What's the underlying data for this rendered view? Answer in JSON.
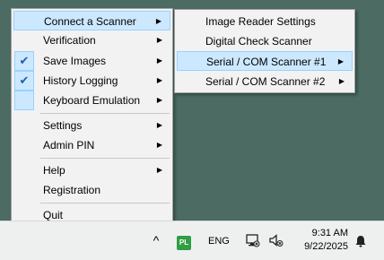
{
  "menu": {
    "items": [
      {
        "label": "Connect a Scanner",
        "has_submenu": true
      },
      {
        "label": "Verification",
        "has_submenu": true
      },
      {
        "label": "Save Images",
        "has_submenu": true,
        "checked": true
      },
      {
        "label": "History Logging",
        "has_submenu": true,
        "checked": true
      },
      {
        "label": "Keyboard Emulation",
        "has_submenu": true
      },
      {
        "label": "Settings",
        "has_submenu": true
      },
      {
        "label": "Admin PIN",
        "has_submenu": true
      },
      {
        "label": "Help",
        "has_submenu": true
      },
      {
        "label": "Registration"
      },
      {
        "label": "Quit"
      }
    ],
    "arrow": "▶",
    "check": "✔"
  },
  "submenu": {
    "items": [
      {
        "label": "Image Reader Settings"
      },
      {
        "label": "Digital Check Scanner"
      },
      {
        "label": "Serial / COM Scanner #1",
        "has_submenu": true
      },
      {
        "label": "Serial / COM Scanner #2",
        "has_submenu": true
      }
    ]
  },
  "taskbar": {
    "overflow_glyph": "^",
    "app_icon_text": "PL",
    "language": "ENG",
    "time": "9:31 AM",
    "date": "9/22/2025"
  },
  "colors": {
    "desktop": "#4b6b63",
    "highlight": "#cce8ff",
    "highlight_border": "#99d1ff",
    "menu_bg": "#f2f2f2"
  }
}
